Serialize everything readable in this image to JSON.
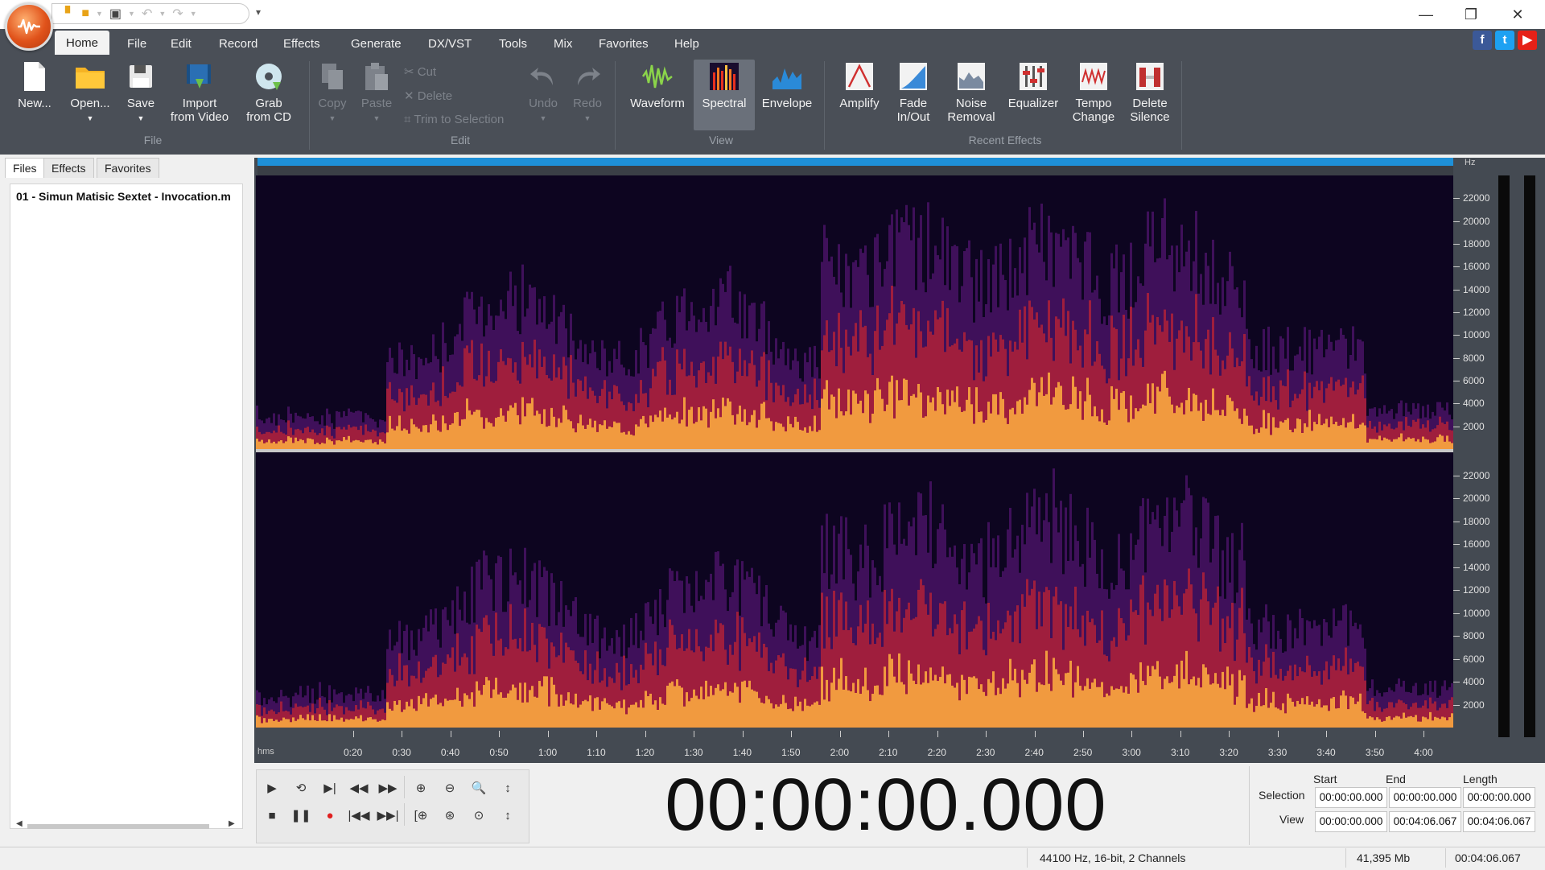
{
  "menu": [
    "Home",
    "File",
    "Edit",
    "Record",
    "Effects",
    "Generate",
    "DX/VST",
    "Tools",
    "Mix",
    "Favorites",
    "Help"
  ],
  "ribbon": {
    "file": {
      "new": "New...",
      "open": "Open...",
      "save": "Save",
      "import1": "Import",
      "import2": "from Video",
      "grab1": "Grab",
      "grab2": "from CD",
      "group": "File"
    },
    "edit": {
      "copy": "Copy",
      "paste": "Paste",
      "cut": "Cut",
      "delete": "Delete",
      "trim": "Trim to Selection",
      "undo": "Undo",
      "redo": "Redo",
      "group": "Edit"
    },
    "view": {
      "waveform": "Waveform",
      "spectral": "Spectral",
      "envelope": "Envelope",
      "group": "View"
    },
    "effects": {
      "amplify": "Amplify",
      "fade1": "Fade",
      "fade2": "In/Out",
      "noise1": "Noise",
      "noise2": "Removal",
      "equalizer": "Equalizer",
      "tempo1": "Tempo",
      "tempo2": "Change",
      "delete1": "Delete",
      "delete2": "Silence",
      "group": "Recent Effects"
    }
  },
  "left_panel": {
    "tabs": [
      "Files",
      "Effects",
      "Favorites"
    ],
    "active_tab": "Files",
    "file": "01 - Simun Matisic Sextet - Invocation.m"
  },
  "freq_axis": {
    "unit": "Hz",
    "ticks": [
      "22000",
      "20000",
      "18000",
      "16000",
      "14000",
      "12000",
      "10000",
      "8000",
      "6000",
      "4000",
      "2000"
    ]
  },
  "time_axis": {
    "unit": "hms",
    "ticks": [
      "0:20",
      "0:30",
      "0:40",
      "0:50",
      "1:00",
      "1:10",
      "1:20",
      "1:30",
      "1:40",
      "1:50",
      "2:00",
      "2:10",
      "2:20",
      "2:30",
      "2:40",
      "2:50",
      "3:00",
      "3:10",
      "3:20",
      "3:30",
      "3:40",
      "3:50",
      "4:00"
    ]
  },
  "transport": {
    "time": "00:00:00.000"
  },
  "selection_panel": {
    "headers": {
      "start": "Start",
      "end": "End",
      "length": "Length"
    },
    "selection": {
      "label": "Selection",
      "start": "00:00:00.000",
      "end": "00:00:00.000",
      "length": "00:00:00.000"
    },
    "view": {
      "label": "View",
      "start": "00:00:00.000",
      "end": "00:04:06.067",
      "length": "00:04:06.067"
    }
  },
  "status": {
    "format": "44100 Hz, 16-bit, 2 Channels",
    "size": "41,395 Mb",
    "duration": "00:04:06.067"
  },
  "colors": {
    "ribbon_bg": "#4a4f57",
    "overview": "#1e90d8",
    "spectro_bg": "#0d0520",
    "accent": "#e0521a"
  },
  "icons": [
    "app-logo",
    "facebook-icon",
    "twitter-icon",
    "youtube-icon"
  ]
}
